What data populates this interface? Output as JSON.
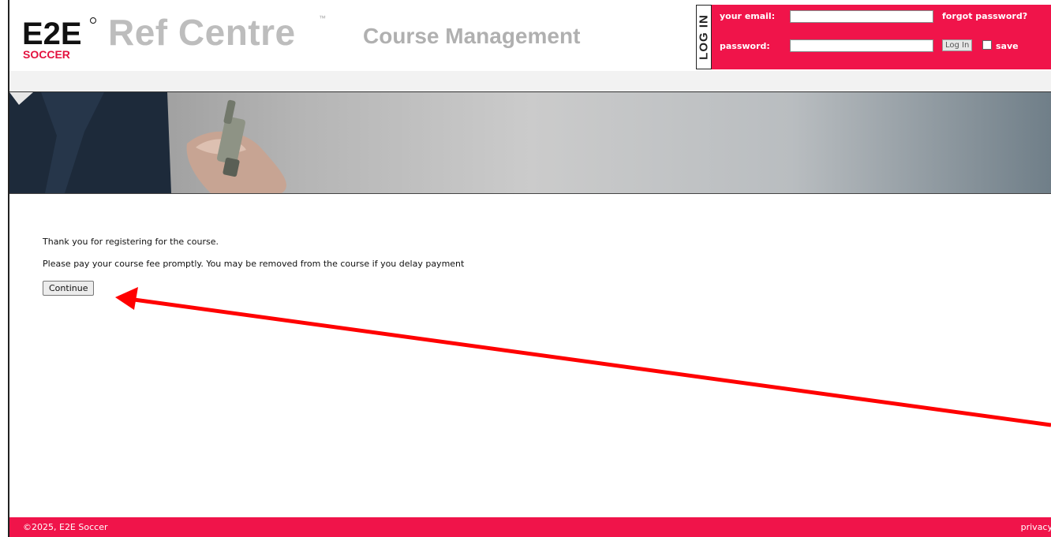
{
  "header": {
    "logo_top": "E2E",
    "logo_bottom": "SOCCER",
    "brand": "Ref Centre",
    "tm": "™",
    "subtitle": "Course Management"
  },
  "login": {
    "tab_label": "LOG IN",
    "email_label": "your email:",
    "email_value": "",
    "password_label": "password:",
    "password_value": "",
    "forgot_label": "forgot password?",
    "login_button": "Log In",
    "save_label": "save"
  },
  "content": {
    "message_1": "Thank you for registering for the course.",
    "message_2": "Please pay your course fee promptly. You may be removed from the course if you delay payment",
    "continue_button": "Continue"
  },
  "footer": {
    "copyright": "©2025, E2E Soccer",
    "privacy": "privacy"
  },
  "colors": {
    "accent": "#f0144a",
    "annotation_arrow": "#ff0000"
  }
}
